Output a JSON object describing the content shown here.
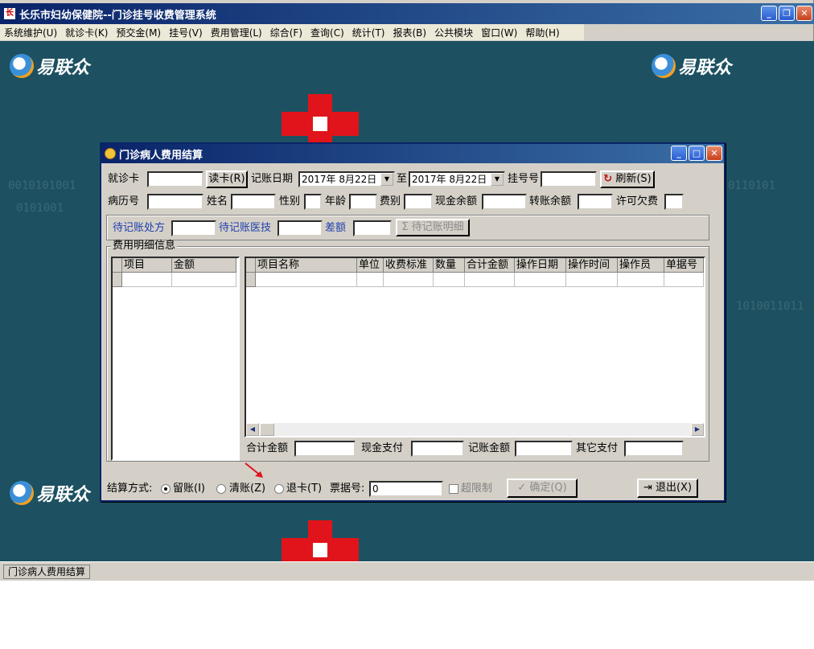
{
  "window": {
    "title": "长乐市妇幼保健院--门诊挂号收费管理系统"
  },
  "menubar": [
    "系统维护(U)",
    "就诊卡(K)",
    "预交金(M)",
    "挂号(V)",
    "费用管理(L)",
    "综合(F)",
    "查询(C)",
    "统计(T)",
    "报表(B)",
    "公共模块",
    "窗口(W)",
    "帮助(H)"
  ],
  "brand": {
    "logo_text": "易联众"
  },
  "dialog": {
    "title": "门诊病人费用结算",
    "row1": {
      "card_label": "就诊卡",
      "read_card_btn": "读卡(R)",
      "date_label": "记账日期",
      "date_from": "2017年 8月22日",
      "to_label": "至",
      "date_to": "2017年 8月22日",
      "reg_no_label": "挂号号",
      "refresh_btn": "刷新(S)"
    },
    "row2": {
      "record_label": "病历号",
      "name_label": "姓名",
      "sex_label": "性别",
      "age_label": "年龄",
      "fee_type_label": "费别",
      "cash_balance_label": "现金余额",
      "transfer_balance_label": "转账余额",
      "allowed_debt_label": "许可欠费"
    },
    "pending": {
      "pending_rx_label": "待记账处方",
      "pending_med_label": "待记账医技",
      "diff_label": "差额",
      "detail_btn": "待记账明细"
    },
    "detail_group": {
      "title": "费用明细信息",
      "left_cols": [
        "项目",
        "金额"
      ],
      "right_cols": [
        "项目名称",
        "单位",
        "收费标准",
        "数量",
        "合计金额",
        "操作日期",
        "操作时间",
        "操作员",
        "单据号"
      ],
      "total_label": "合计金额",
      "cash_pay_label": "现金支付",
      "account_amt_label": "记账金额",
      "other_pay_label": "其它支付"
    },
    "footer": {
      "settle_label": "结算方式:",
      "option_keep": "留账(I)",
      "option_clear": "清账(Z)",
      "option_return": "退卡(T)",
      "ticket_label": "票据号:",
      "ticket_value": "0",
      "over_limit_label": "超限制",
      "confirm_btn": "确定(Q)",
      "exit_btn": "退出(X)"
    }
  },
  "statusbar": {
    "tab": "门诊病人费用结算"
  },
  "colors": {
    "title_bar": "#0a246a",
    "desktop": "#1d5161",
    "brand_red": "#e0141a",
    "label_blue": "#1f3fae"
  }
}
